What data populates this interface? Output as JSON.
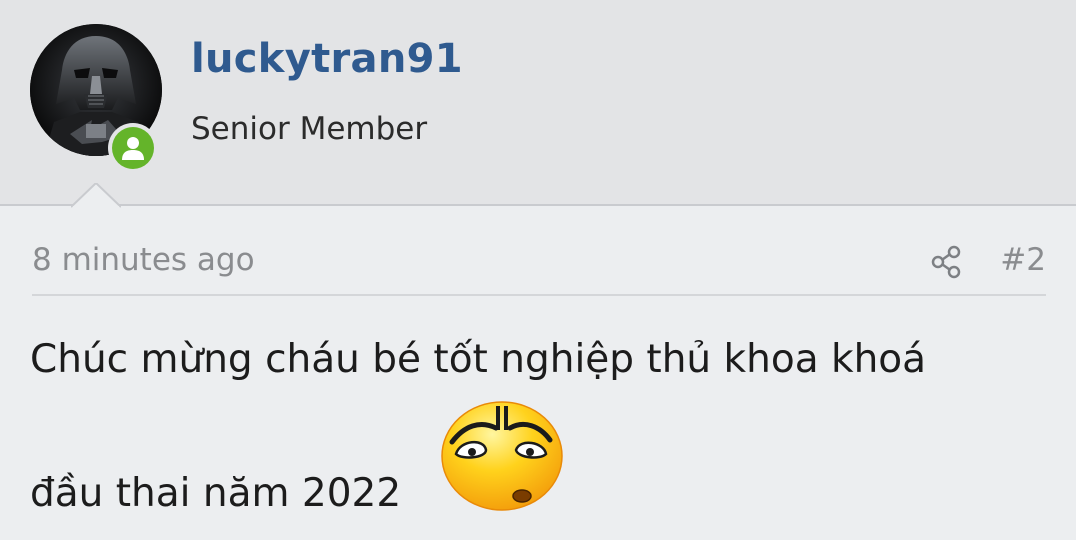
{
  "post": {
    "author": {
      "username": "luckytran91",
      "title": "Senior Member",
      "status": "online"
    },
    "meta": {
      "timestamp": "8 minutes ago",
      "post_number": "#2",
      "share_icon": "share-icon"
    },
    "message": {
      "line1": "Chúc mừng cháu bé tốt nghiệp thủ khoa khoá",
      "line2": "đầu thai năm 2022",
      "emoji": "worried-smiley-icon"
    }
  },
  "colors": {
    "username": "#2f5a8f",
    "online": "#64b42a",
    "header_bg": "#e3e4e6",
    "body_bg": "#eceef0",
    "muted_text": "#8a8c8f"
  }
}
